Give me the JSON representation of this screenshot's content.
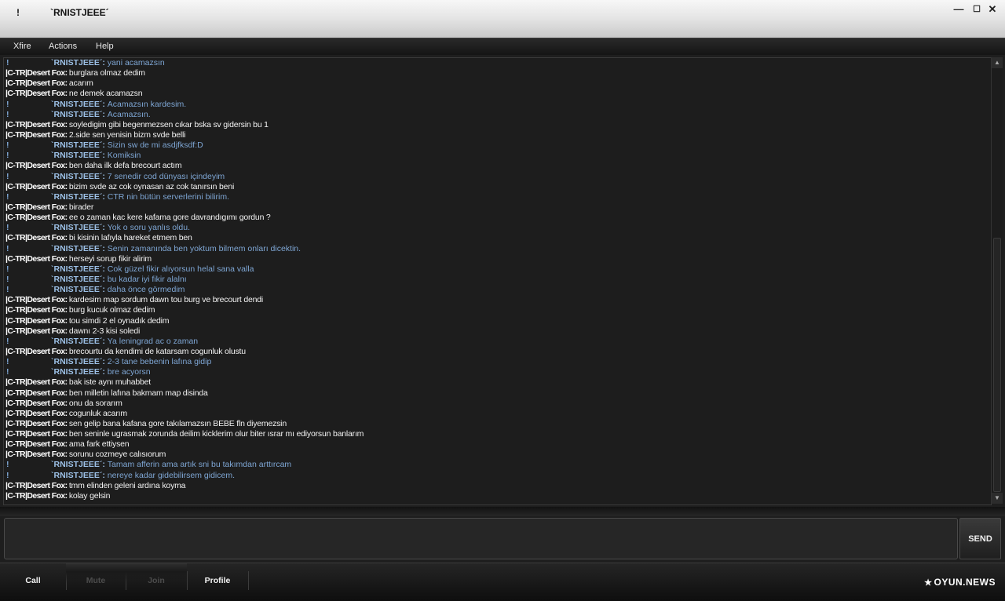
{
  "window": {
    "title_excl": "!",
    "title": "`RNISTJEEE´",
    "controls": [
      "—",
      "☐",
      "✕"
    ]
  },
  "menu": [
    "Xfire",
    "Actions",
    "Help"
  ],
  "messages": [
    {
      "type": "rn",
      "nick": "`RNISTJEEE´",
      "text": "yani acamazsın"
    },
    {
      "type": "fox",
      "nick": "|C-TR|Desert Fox",
      "text": "burglara olmaz dedim"
    },
    {
      "type": "fox",
      "nick": "|C-TR|Desert Fox",
      "text": "acarım"
    },
    {
      "type": "fox",
      "nick": "|C-TR|Desert Fox",
      "text": "ne demek acamazsn"
    },
    {
      "type": "rn",
      "nick": "`RNISTJEEE´",
      "text": "Acamazsın kardesim."
    },
    {
      "type": "rn",
      "nick": "`RNISTJEEE´",
      "text": "Acamazsın."
    },
    {
      "type": "fox",
      "nick": "|C-TR|Desert Fox",
      "text": "soyledigim gibi begenmezsen cıkar bska sv gidersin bu 1"
    },
    {
      "type": "fox",
      "nick": "|C-TR|Desert Fox",
      "text": "2.side sen yenisin bizm svde belli"
    },
    {
      "type": "rn",
      "nick": "`RNISTJEEE´",
      "text": "Sizin sw de mi asdjfksdf:D"
    },
    {
      "type": "rn",
      "nick": "`RNISTJEEE´",
      "text": "Komiksin"
    },
    {
      "type": "fox",
      "nick": "|C-TR|Desert Fox",
      "text": "ben daha ilk defa brecourt actım"
    },
    {
      "type": "rn",
      "nick": "`RNISTJEEE´",
      "text": "7 senedir cod dünyası içindeyim"
    },
    {
      "type": "fox",
      "nick": "|C-TR|Desert Fox",
      "text": "bizim svde az cok oynasan az cok tanırsın beni"
    },
    {
      "type": "rn",
      "nick": "`RNISTJEEE´",
      "text": "CTR nin bütün serverlerini bilirim."
    },
    {
      "type": "fox",
      "nick": "|C-TR|Desert Fox",
      "text": "birader"
    },
    {
      "type": "fox",
      "nick": "|C-TR|Desert Fox",
      "text": "ee o zaman kac kere kafama gore davrandıgımı gordun ?"
    },
    {
      "type": "rn",
      "nick": "`RNISTJEEE´",
      "text": "Yok o soru yanlıs oldu."
    },
    {
      "type": "fox",
      "nick": "|C-TR|Desert Fox",
      "text": "bi kisinin lafıyla hareket etmem ben"
    },
    {
      "type": "rn",
      "nick": "`RNISTJEEE´",
      "text": "Senin zamanında ben yoktum bilmem onları dicektin."
    },
    {
      "type": "fox",
      "nick": "|C-TR|Desert Fox",
      "text": "herseyi sorup fikir alirim"
    },
    {
      "type": "rn",
      "nick": "`RNISTJEEE´",
      "text": "Cok güzel fikir alıyorsun helal sana valla"
    },
    {
      "type": "rn",
      "nick": "`RNISTJEEE´",
      "text": "bu kadar iyi fikir alalnı"
    },
    {
      "type": "rn",
      "nick": "`RNISTJEEE´",
      "text": "daha önce görmedim"
    },
    {
      "type": "fox",
      "nick": "|C-TR|Desert Fox",
      "text": "kardesim map sordum dawn tou burg ve brecourt dendi"
    },
    {
      "type": "fox",
      "nick": "|C-TR|Desert Fox",
      "text": "burg kucuk olmaz dedim"
    },
    {
      "type": "fox",
      "nick": "|C-TR|Desert Fox",
      "text": "tou simdi 2 el oynadık dedim"
    },
    {
      "type": "fox",
      "nick": "|C-TR|Desert Fox",
      "text": "dawnı 2-3 kisi soledi"
    },
    {
      "type": "rn",
      "nick": "`RNISTJEEE´",
      "text": "Ya leningrad ac o zaman"
    },
    {
      "type": "fox",
      "nick": "|C-TR|Desert Fox",
      "text": "brecourtu da kendimi de katarsam cogunluk olustu"
    },
    {
      "type": "rn",
      "nick": "`RNISTJEEE´",
      "text": "2-3 tane bebenin lafına gidip"
    },
    {
      "type": "rn",
      "nick": "`RNISTJEEE´",
      "text": "bre acyorsn"
    },
    {
      "type": "fox",
      "nick": "|C-TR|Desert Fox",
      "text": "bak iste aynı muhabbet"
    },
    {
      "type": "fox",
      "nick": "|C-TR|Desert Fox",
      "text": "ben milletin lafına bakmam map disinda"
    },
    {
      "type": "fox",
      "nick": "|C-TR|Desert Fox",
      "text": "onu da sorarım"
    },
    {
      "type": "fox",
      "nick": "|C-TR|Desert Fox",
      "text": "cogunluk acarım"
    },
    {
      "type": "fox",
      "nick": "|C-TR|Desert Fox",
      "text": "sen gelip bana kafana gore takılamazsın BEBE fln diyemezsin"
    },
    {
      "type": "fox",
      "nick": "|C-TR|Desert Fox",
      "text": "ben seninle ugrasmak zorunda deilim kicklerim olur biter ısrar mı ediyorsun banlarım"
    },
    {
      "type": "fox",
      "nick": "|C-TR|Desert Fox",
      "text": "ama fark ettiysen"
    },
    {
      "type": "fox",
      "nick": "|C-TR|Desert Fox",
      "text": "sorunu cozmeye calısıorum"
    },
    {
      "type": "rn",
      "nick": "`RNISTJEEE´",
      "text": "Tamam afferin ama artık sni bu takımdan arttırcam"
    },
    {
      "type": "rn",
      "nick": "`RNISTJEEE´",
      "text": "nereye kadar gidebilirsem gidicem."
    },
    {
      "type": "fox",
      "nick": "|C-TR|Desert Fox",
      "text": "tmm elinden geleni ardına koyma"
    },
    {
      "type": "fox",
      "nick": "|C-TR|Desert Fox",
      "text": "kolay gelsin"
    }
  ],
  "message_prefix": "!",
  "separator": ": ",
  "input": {
    "value": ""
  },
  "send_label": "SEND",
  "bottom_buttons": [
    {
      "label": "Call",
      "enabled": true
    },
    {
      "label": "Mute",
      "enabled": false
    },
    {
      "label": "Join",
      "enabled": false
    },
    {
      "label": "Profile",
      "enabled": true
    }
  ],
  "logo": {
    "text": "OYUN.NEWS",
    "symbol": "★"
  }
}
